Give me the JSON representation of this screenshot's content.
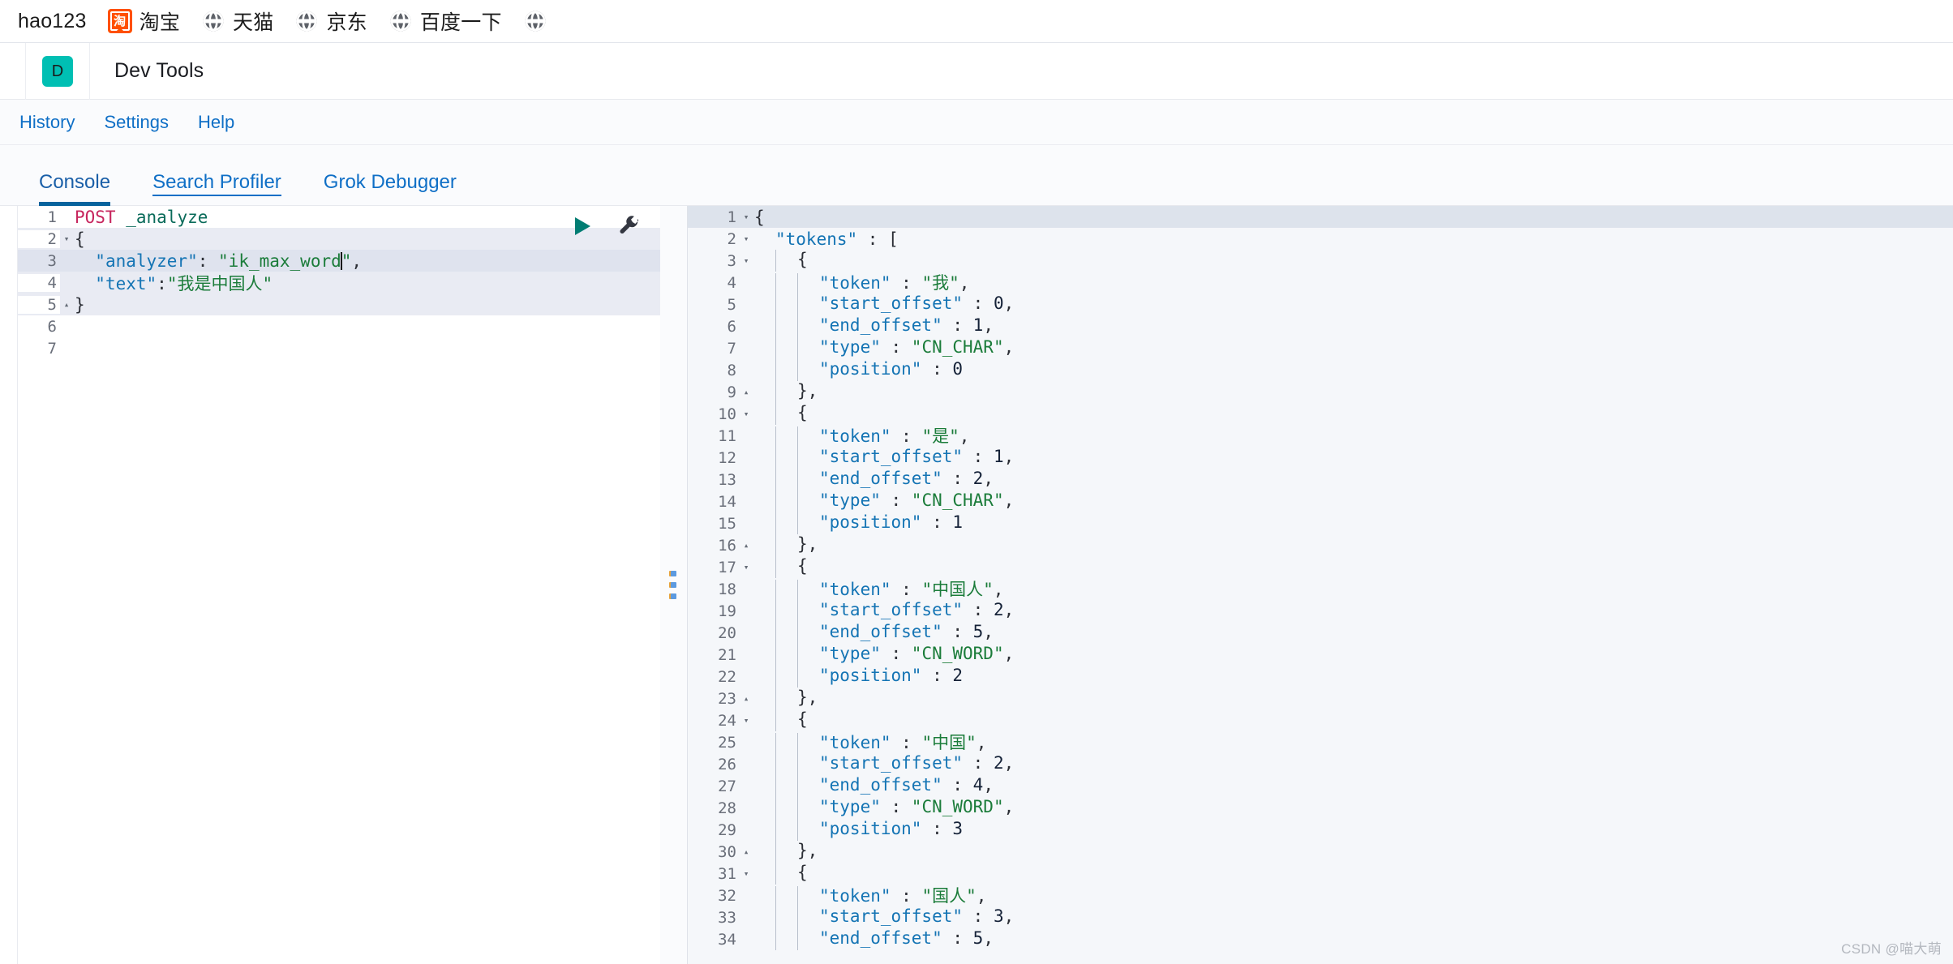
{
  "browser": {
    "bookmarks": [
      {
        "label": "hao123",
        "icon": "none"
      },
      {
        "label": "淘宝",
        "icon": "taobao-icon"
      },
      {
        "label": "天猫",
        "icon": "globe-icon"
      },
      {
        "label": "京东",
        "icon": "globe-icon"
      },
      {
        "label": "百度一下",
        "icon": "globe-icon"
      },
      {
        "label": "",
        "icon": "globe-icon"
      }
    ]
  },
  "header": {
    "avatar_letter": "D",
    "avatar_color": "#00bfb3",
    "title": "Dev Tools"
  },
  "nav": {
    "links": [
      {
        "label": "History"
      },
      {
        "label": "Settings"
      },
      {
        "label": "Help"
      }
    ]
  },
  "tabs": [
    {
      "label": "Console",
      "state": "active"
    },
    {
      "label": "Search Profiler",
      "state": "hover"
    },
    {
      "label": "Grok Debugger",
      "state": "normal"
    }
  ],
  "editor": {
    "actions": [
      {
        "name": "send-request-button",
        "icon": "play-icon",
        "color": "#017d73"
      },
      {
        "name": "open-documentation-button",
        "icon": "wrench-icon",
        "color": "#343741"
      }
    ],
    "lines": [
      {
        "n": "1",
        "fold": "",
        "state": "plain"
      },
      {
        "n": "2",
        "fold": "▾",
        "state": "req"
      },
      {
        "n": "3",
        "fold": "",
        "state": "active"
      },
      {
        "n": "4",
        "fold": "",
        "state": "req"
      },
      {
        "n": "5",
        "fold": "▴",
        "state": "req"
      },
      {
        "n": "6",
        "fold": "",
        "state": "plain"
      },
      {
        "n": "7",
        "fold": "",
        "state": "plain"
      }
    ],
    "request_text": {
      "method": "POST",
      "endpoint": "_analyze",
      "brace_open": "{",
      "key_analyzer": "\"analyzer\"",
      "val_analyzer": "\"ik_max_word\"",
      "key_text": "\"text\"",
      "val_text": "\"我是中国人\"",
      "brace_close": "}",
      "colon": ": ",
      "comma": ","
    }
  },
  "splitter": {
    "name": "pane-resize-handle"
  },
  "response": {
    "lines": [
      {
        "n": "1",
        "fold": "▾",
        "state": "active",
        "indent": 0,
        "guides": 0,
        "segs": [
          {
            "t": "punct",
            "v": "{"
          }
        ]
      },
      {
        "n": "2",
        "fold": "▾",
        "state": "plain",
        "indent": 1,
        "guides": 0,
        "segs": [
          {
            "t": "key",
            "v": "\"tokens\""
          },
          {
            "t": "punct",
            "v": " : "
          },
          {
            "t": "punct",
            "v": "["
          }
        ]
      },
      {
        "n": "3",
        "fold": "▾",
        "state": "plain",
        "indent": 2,
        "guides": 1,
        "segs": [
          {
            "t": "punct",
            "v": "{"
          }
        ]
      },
      {
        "n": "4",
        "fold": "",
        "state": "plain",
        "indent": 3,
        "guides": 2,
        "segs": [
          {
            "t": "key",
            "v": "\"token\""
          },
          {
            "t": "punct",
            "v": " : "
          },
          {
            "t": "str",
            "v": "\"我\""
          },
          {
            "t": "punct",
            "v": ","
          }
        ]
      },
      {
        "n": "5",
        "fold": "",
        "state": "plain",
        "indent": 3,
        "guides": 2,
        "segs": [
          {
            "t": "key",
            "v": "\"start_offset\""
          },
          {
            "t": "punct",
            "v": " : "
          },
          {
            "t": "num",
            "v": "0"
          },
          {
            "t": "punct",
            "v": ","
          }
        ]
      },
      {
        "n": "6",
        "fold": "",
        "state": "plain",
        "indent": 3,
        "guides": 2,
        "segs": [
          {
            "t": "key",
            "v": "\"end_offset\""
          },
          {
            "t": "punct",
            "v": " : "
          },
          {
            "t": "num",
            "v": "1"
          },
          {
            "t": "punct",
            "v": ","
          }
        ]
      },
      {
        "n": "7",
        "fold": "",
        "state": "plain",
        "indent": 3,
        "guides": 2,
        "segs": [
          {
            "t": "key",
            "v": "\"type\""
          },
          {
            "t": "punct",
            "v": " : "
          },
          {
            "t": "str",
            "v": "\"CN_CHAR\""
          },
          {
            "t": "punct",
            "v": ","
          }
        ]
      },
      {
        "n": "8",
        "fold": "",
        "state": "plain",
        "indent": 3,
        "guides": 2,
        "segs": [
          {
            "t": "key",
            "v": "\"position\""
          },
          {
            "t": "punct",
            "v": " : "
          },
          {
            "t": "num",
            "v": "0"
          }
        ]
      },
      {
        "n": "9",
        "fold": "▴",
        "state": "plain",
        "indent": 2,
        "guides": 1,
        "segs": [
          {
            "t": "punct",
            "v": "},"
          }
        ]
      },
      {
        "n": "10",
        "fold": "▾",
        "state": "plain",
        "indent": 2,
        "guides": 1,
        "segs": [
          {
            "t": "punct",
            "v": "{"
          }
        ]
      },
      {
        "n": "11",
        "fold": "",
        "state": "plain",
        "indent": 3,
        "guides": 2,
        "segs": [
          {
            "t": "key",
            "v": "\"token\""
          },
          {
            "t": "punct",
            "v": " : "
          },
          {
            "t": "str",
            "v": "\"是\""
          },
          {
            "t": "punct",
            "v": ","
          }
        ]
      },
      {
        "n": "12",
        "fold": "",
        "state": "plain",
        "indent": 3,
        "guides": 2,
        "segs": [
          {
            "t": "key",
            "v": "\"start_offset\""
          },
          {
            "t": "punct",
            "v": " : "
          },
          {
            "t": "num",
            "v": "1"
          },
          {
            "t": "punct",
            "v": ","
          }
        ]
      },
      {
        "n": "13",
        "fold": "",
        "state": "plain",
        "indent": 3,
        "guides": 2,
        "segs": [
          {
            "t": "key",
            "v": "\"end_offset\""
          },
          {
            "t": "punct",
            "v": " : "
          },
          {
            "t": "num",
            "v": "2"
          },
          {
            "t": "punct",
            "v": ","
          }
        ]
      },
      {
        "n": "14",
        "fold": "",
        "state": "plain",
        "indent": 3,
        "guides": 2,
        "segs": [
          {
            "t": "key",
            "v": "\"type\""
          },
          {
            "t": "punct",
            "v": " : "
          },
          {
            "t": "str",
            "v": "\"CN_CHAR\""
          },
          {
            "t": "punct",
            "v": ","
          }
        ]
      },
      {
        "n": "15",
        "fold": "",
        "state": "plain",
        "indent": 3,
        "guides": 2,
        "segs": [
          {
            "t": "key",
            "v": "\"position\""
          },
          {
            "t": "punct",
            "v": " : "
          },
          {
            "t": "num",
            "v": "1"
          }
        ]
      },
      {
        "n": "16",
        "fold": "▴",
        "state": "plain",
        "indent": 2,
        "guides": 1,
        "segs": [
          {
            "t": "punct",
            "v": "},"
          }
        ]
      },
      {
        "n": "17",
        "fold": "▾",
        "state": "plain",
        "indent": 2,
        "guides": 1,
        "segs": [
          {
            "t": "punct",
            "v": "{"
          }
        ]
      },
      {
        "n": "18",
        "fold": "",
        "state": "plain",
        "indent": 3,
        "guides": 2,
        "segs": [
          {
            "t": "key",
            "v": "\"token\""
          },
          {
            "t": "punct",
            "v": " : "
          },
          {
            "t": "str",
            "v": "\"中国人\""
          },
          {
            "t": "punct",
            "v": ","
          }
        ]
      },
      {
        "n": "19",
        "fold": "",
        "state": "plain",
        "indent": 3,
        "guides": 2,
        "segs": [
          {
            "t": "key",
            "v": "\"start_offset\""
          },
          {
            "t": "punct",
            "v": " : "
          },
          {
            "t": "num",
            "v": "2"
          },
          {
            "t": "punct",
            "v": ","
          }
        ]
      },
      {
        "n": "20",
        "fold": "",
        "state": "plain",
        "indent": 3,
        "guides": 2,
        "segs": [
          {
            "t": "key",
            "v": "\"end_offset\""
          },
          {
            "t": "punct",
            "v": " : "
          },
          {
            "t": "num",
            "v": "5"
          },
          {
            "t": "punct",
            "v": ","
          }
        ]
      },
      {
        "n": "21",
        "fold": "",
        "state": "plain",
        "indent": 3,
        "guides": 2,
        "segs": [
          {
            "t": "key",
            "v": "\"type\""
          },
          {
            "t": "punct",
            "v": " : "
          },
          {
            "t": "str",
            "v": "\"CN_WORD\""
          },
          {
            "t": "punct",
            "v": ","
          }
        ]
      },
      {
        "n": "22",
        "fold": "",
        "state": "plain",
        "indent": 3,
        "guides": 2,
        "segs": [
          {
            "t": "key",
            "v": "\"position\""
          },
          {
            "t": "punct",
            "v": " : "
          },
          {
            "t": "num",
            "v": "2"
          }
        ]
      },
      {
        "n": "23",
        "fold": "▴",
        "state": "plain",
        "indent": 2,
        "guides": 1,
        "segs": [
          {
            "t": "punct",
            "v": "},"
          }
        ]
      },
      {
        "n": "24",
        "fold": "▾",
        "state": "plain",
        "indent": 2,
        "guides": 1,
        "segs": [
          {
            "t": "punct",
            "v": "{"
          }
        ]
      },
      {
        "n": "25",
        "fold": "",
        "state": "plain",
        "indent": 3,
        "guides": 2,
        "segs": [
          {
            "t": "key",
            "v": "\"token\""
          },
          {
            "t": "punct",
            "v": " : "
          },
          {
            "t": "str",
            "v": "\"中国\""
          },
          {
            "t": "punct",
            "v": ","
          }
        ]
      },
      {
        "n": "26",
        "fold": "",
        "state": "plain",
        "indent": 3,
        "guides": 2,
        "segs": [
          {
            "t": "key",
            "v": "\"start_offset\""
          },
          {
            "t": "punct",
            "v": " : "
          },
          {
            "t": "num",
            "v": "2"
          },
          {
            "t": "punct",
            "v": ","
          }
        ]
      },
      {
        "n": "27",
        "fold": "",
        "state": "plain",
        "indent": 3,
        "guides": 2,
        "segs": [
          {
            "t": "key",
            "v": "\"end_offset\""
          },
          {
            "t": "punct",
            "v": " : "
          },
          {
            "t": "num",
            "v": "4"
          },
          {
            "t": "punct",
            "v": ","
          }
        ]
      },
      {
        "n": "28",
        "fold": "",
        "state": "plain",
        "indent": 3,
        "guides": 2,
        "segs": [
          {
            "t": "key",
            "v": "\"type\""
          },
          {
            "t": "punct",
            "v": " : "
          },
          {
            "t": "str",
            "v": "\"CN_WORD\""
          },
          {
            "t": "punct",
            "v": ","
          }
        ]
      },
      {
        "n": "29",
        "fold": "",
        "state": "plain",
        "indent": 3,
        "guides": 2,
        "segs": [
          {
            "t": "key",
            "v": "\"position\""
          },
          {
            "t": "punct",
            "v": " : "
          },
          {
            "t": "num",
            "v": "3"
          }
        ]
      },
      {
        "n": "30",
        "fold": "▴",
        "state": "plain",
        "indent": 2,
        "guides": 1,
        "segs": [
          {
            "t": "punct",
            "v": "},"
          }
        ]
      },
      {
        "n": "31",
        "fold": "▾",
        "state": "plain",
        "indent": 2,
        "guides": 1,
        "segs": [
          {
            "t": "punct",
            "v": "{"
          }
        ]
      },
      {
        "n": "32",
        "fold": "",
        "state": "plain",
        "indent": 3,
        "guides": 2,
        "segs": [
          {
            "t": "key",
            "v": "\"token\""
          },
          {
            "t": "punct",
            "v": " : "
          },
          {
            "t": "str",
            "v": "\"国人\""
          },
          {
            "t": "punct",
            "v": ","
          }
        ]
      },
      {
        "n": "33",
        "fold": "",
        "state": "plain",
        "indent": 3,
        "guides": 2,
        "segs": [
          {
            "t": "key",
            "v": "\"start_offset\""
          },
          {
            "t": "punct",
            "v": " : "
          },
          {
            "t": "num",
            "v": "3"
          },
          {
            "t": "punct",
            "v": ","
          }
        ]
      },
      {
        "n": "34",
        "fold": "",
        "state": "plain",
        "indent": 3,
        "guides": 2,
        "segs": [
          {
            "t": "key",
            "v": "\"end_offset\""
          },
          {
            "t": "punct",
            "v": " : "
          },
          {
            "t": "num",
            "v": "5"
          },
          {
            "t": "punct",
            "v": ","
          }
        ]
      }
    ]
  },
  "watermark": {
    "text": "CSDN @喵大萌"
  }
}
